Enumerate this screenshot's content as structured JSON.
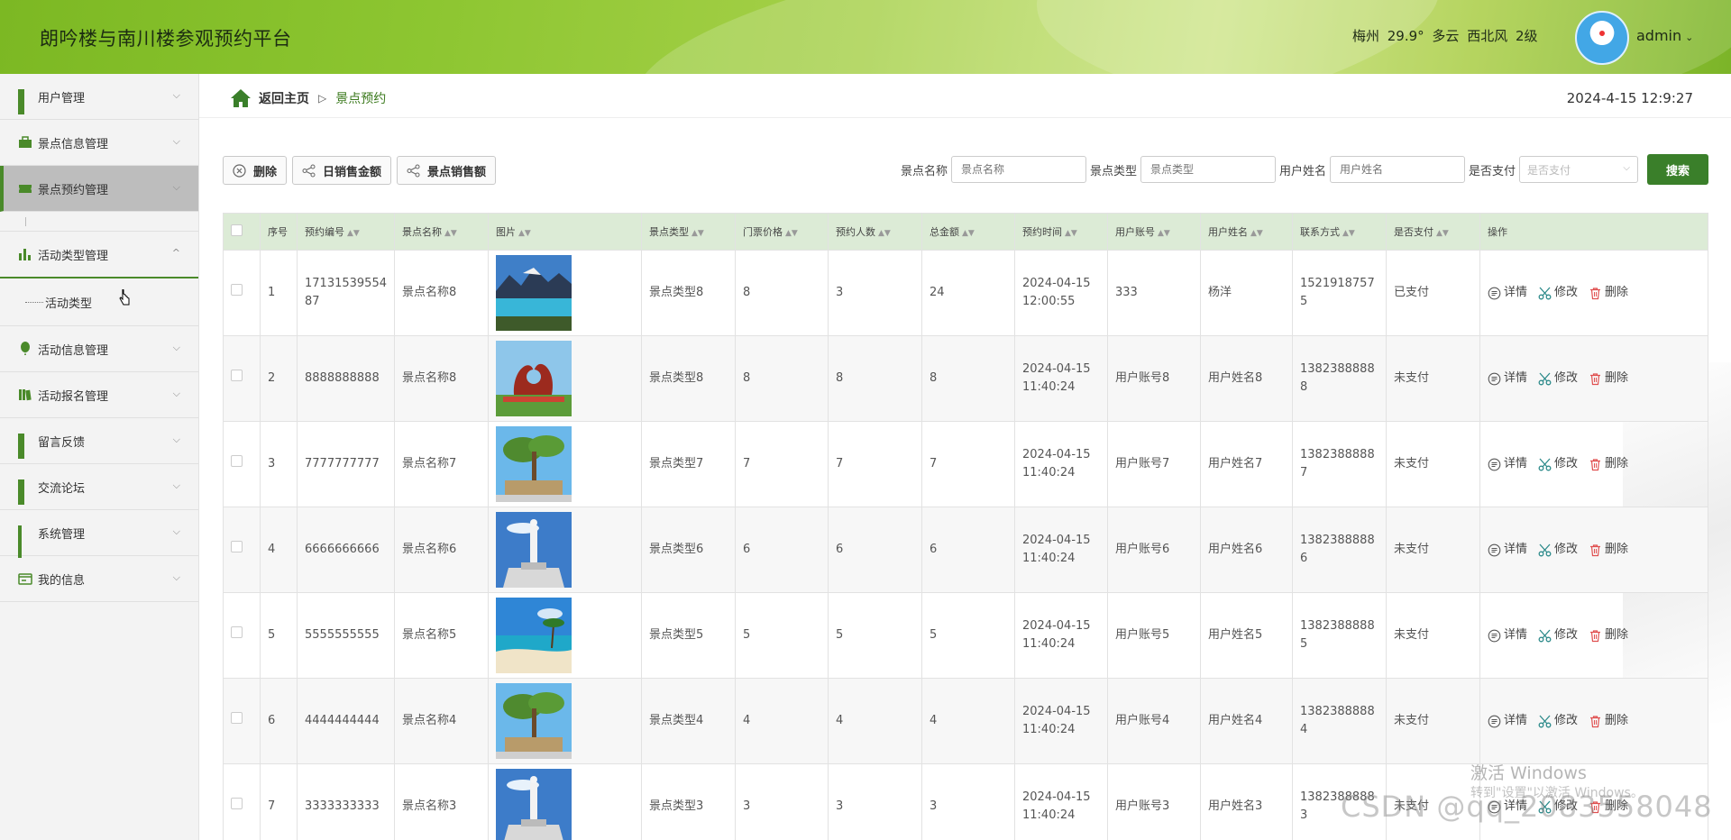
{
  "header": {
    "title": "朗吟楼与南川楼参观预约平台",
    "weather": "梅州 29.9° 多云 西北风 2级",
    "user": "admin"
  },
  "sidebar": {
    "items": [
      {
        "label": "用户管理",
        "icon": "grid-icon"
      },
      {
        "label": "景点信息管理",
        "icon": "briefcase-icon"
      },
      {
        "label": "景点预约管理",
        "icon": "ticket-icon"
      },
      {
        "label": "活动类型管理",
        "icon": "bar-chart-icon"
      },
      {
        "label": "活动信息管理",
        "icon": "balloon-icon"
      },
      {
        "label": "活动报名管理",
        "icon": "books-icon"
      },
      {
        "label": "留言反馈",
        "icon": "grid-icon"
      },
      {
        "label": "交流论坛",
        "icon": "grid-icon"
      },
      {
        "label": "系统管理",
        "icon": "grid9-icon"
      },
      {
        "label": "我的信息",
        "icon": "card-icon"
      }
    ],
    "submenu": {
      "label": "活动类型"
    }
  },
  "breadcrumb": {
    "home": "返回主页",
    "separator": "▷",
    "current": "景点预约"
  },
  "datetime": "2024-4-15 12:9:27",
  "toolbar": {
    "delete": "删除",
    "daily_sales": "日销售金额",
    "spot_sales": "景点销售额"
  },
  "filters": {
    "spot_name_label": "景点名称",
    "spot_name_placeholder": "景点名称",
    "spot_type_label": "景点类型",
    "spot_type_placeholder": "景点类型",
    "user_name_label": "用户姓名",
    "user_name_placeholder": "用户姓名",
    "paid_label": "是否支付",
    "paid_placeholder": "是否支付",
    "search": "搜索"
  },
  "table": {
    "headers": [
      "序号",
      "预约编号",
      "景点名称",
      "图片",
      "景点类型",
      "门票价格",
      "预约人数",
      "总金额",
      "预约时间",
      "用户账号",
      "用户姓名",
      "联系方式",
      "是否支付",
      "操作"
    ],
    "actions": {
      "detail": "详情",
      "edit": "修改",
      "delete": "删除"
    },
    "rows": [
      {
        "no": "1",
        "code": "1713153955487",
        "name": "景点名称8",
        "type": "景点类型8",
        "price": "8",
        "count": "3",
        "total": "24",
        "time": "2024-04-15 12:00:55",
        "account": "333",
        "uname": "杨洋",
        "phone": "15219187575",
        "paid": "已支付",
        "img": "lake"
      },
      {
        "no": "2",
        "code": "8888888888",
        "name": "景点名称8",
        "type": "景点类型8",
        "price": "8",
        "count": "8",
        "total": "8",
        "time": "2024-04-15 11:40:24",
        "account": "用户账号8",
        "uname": "用户姓名8",
        "phone": "13823888888",
        "paid": "未支付",
        "img": "sculpture"
      },
      {
        "no": "3",
        "code": "7777777777",
        "name": "景点名称7",
        "type": "景点类型7",
        "price": "7",
        "count": "7",
        "total": "7",
        "time": "2024-04-15 11:40:24",
        "account": "用户账号7",
        "uname": "用户姓名7",
        "phone": "13823888887",
        "paid": "未支付",
        "img": "tree"
      },
      {
        "no": "4",
        "code": "6666666666",
        "name": "景点名称6",
        "type": "景点类型6",
        "price": "6",
        "count": "6",
        "total": "6",
        "time": "2024-04-15 11:40:24",
        "account": "用户账号6",
        "uname": "用户姓名6",
        "phone": "13823888886",
        "paid": "未支付",
        "img": "statue"
      },
      {
        "no": "5",
        "code": "5555555555",
        "name": "景点名称5",
        "type": "景点类型5",
        "price": "5",
        "count": "5",
        "total": "5",
        "time": "2024-04-15 11:40:24",
        "account": "用户账号5",
        "uname": "用户姓名5",
        "phone": "13823888885",
        "paid": "未支付",
        "img": "beach"
      },
      {
        "no": "6",
        "code": "4444444444",
        "name": "景点名称4",
        "type": "景点类型4",
        "price": "4",
        "count": "4",
        "total": "4",
        "time": "2024-04-15 11:40:24",
        "account": "用户账号4",
        "uname": "用户姓名4",
        "phone": "13823888884",
        "paid": "未支付",
        "img": "tree"
      },
      {
        "no": "7",
        "code": "3333333333",
        "name": "景点名称3",
        "type": "景点类型3",
        "price": "3",
        "count": "3",
        "total": "3",
        "time": "2024-04-15 11:40:24",
        "account": "用户账号3",
        "uname": "用户姓名3",
        "phone": "13823888883",
        "paid": "未支付",
        "img": "statue"
      }
    ]
  },
  "watermark": {
    "line1": "激活 Windows",
    "line2": "转到\"设置\"以激活 Windows。",
    "csdn": "CSDN @qq_2083558048"
  },
  "colors": {
    "accent": "#3a7f2a",
    "header": "#8dc631",
    "table_head": "#dcebd6"
  }
}
